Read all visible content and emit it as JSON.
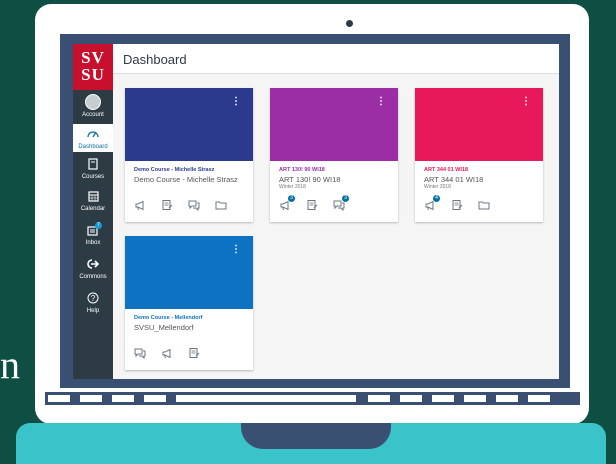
{
  "background_glyph": "n",
  "colors": {
    "brand_red": "#c8102e",
    "sidebar": "#2d3b45",
    "link_blue": "#0770a3"
  },
  "sidebar": {
    "logo_line1": "SV",
    "logo_line2": "SU",
    "items": [
      {
        "label": "Account",
        "icon": "avatar-icon"
      },
      {
        "label": "Dashboard",
        "icon": "dashboard-icon",
        "active": true
      },
      {
        "label": "Courses",
        "icon": "book-icon"
      },
      {
        "label": "Calendar",
        "icon": "calendar-icon"
      },
      {
        "label": "Inbox",
        "icon": "inbox-icon",
        "badge": "7"
      },
      {
        "label": "Commons",
        "icon": "commons-icon"
      },
      {
        "label": "Help",
        "icon": "help-icon"
      }
    ]
  },
  "header": {
    "title": "Dashboard"
  },
  "cards": [
    {
      "color": "#2b3a8c",
      "title": "Demo Course - Michelle Strasz",
      "title_color": "#2b3a8c",
      "subtitle": "Demo Course - Michelle Strasz",
      "term": "",
      "icons": [
        "announcement-icon",
        "assignment-icon",
        "discussion-icon",
        "folder-icon"
      ],
      "badges": {}
    },
    {
      "color": "#9b2ea4",
      "title": "ART 130! 90 WI18",
      "title_color": "#9b2ea4",
      "subtitle": "ART 130! 90 WI18",
      "term": "Winter 2018",
      "icons": [
        "announcement-icon",
        "assignment-icon",
        "discussion-icon"
      ],
      "badges": {
        "announcement-icon": "3",
        "discussion-icon": "3"
      }
    },
    {
      "color": "#e8195a",
      "title": "ART 344 01 WI18",
      "title_color": "#e8195a",
      "subtitle": "ART 344 01 WI18",
      "term": "Winter 2018",
      "icons": [
        "announcement-icon",
        "assignment-icon",
        "folder-icon"
      ],
      "badges": {
        "announcement-icon": "4"
      }
    },
    {
      "color": "#0d72c1",
      "title": "Demo Course - Mellendorf",
      "title_color": "#0d72c1",
      "subtitle": "SVSU_Mellendorf",
      "term": "",
      "icons": [
        "discussion-icon",
        "announcement-icon",
        "assignment-icon"
      ],
      "badges": {}
    }
  ]
}
